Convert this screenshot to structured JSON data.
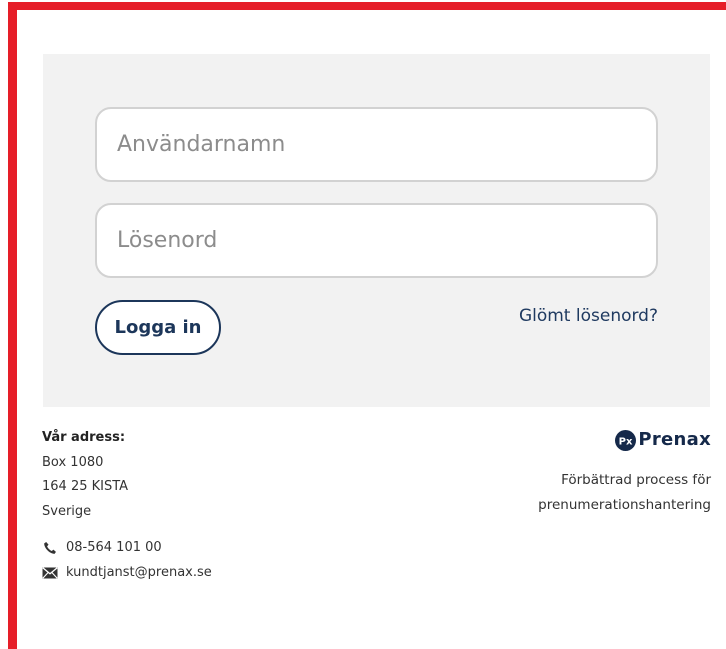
{
  "login": {
    "username_placeholder": "Användarnamn",
    "username_value": "",
    "password_placeholder": "Lösenord",
    "password_value": "",
    "submit_label": "Logga in",
    "forgot_password_label": "Glömt lösenord?"
  },
  "footer": {
    "address_heading": "Vår adress:",
    "address_lines": [
      "Box 1080",
      "164 25 KISTA",
      "Sverige"
    ],
    "phone": "08-564 101 00",
    "email": "kundtjanst@prenax.se",
    "brand": {
      "logo_mark": "Px",
      "name": "Prenax",
      "tagline_lines": [
        "Förbättrad process för",
        "prenumerationshantering"
      ]
    }
  },
  "icons": {
    "phone": "phone-icon",
    "email": "mail-icon",
    "logo": "prenax-logo-icon"
  },
  "colors": {
    "frame_red": "#e61e28",
    "brand_navy": "#1c365a",
    "panel_background": "#f2f2f2"
  }
}
